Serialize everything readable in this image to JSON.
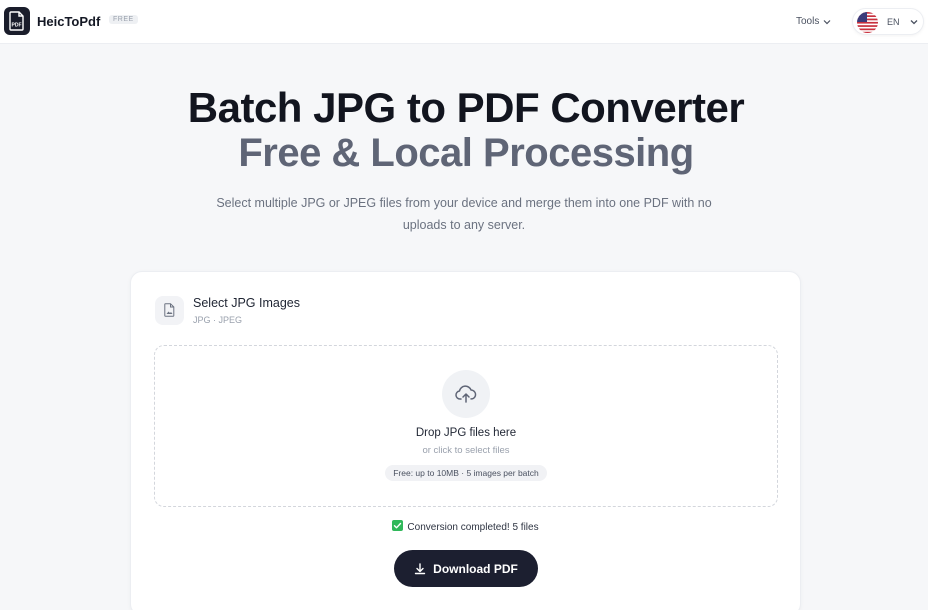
{
  "header": {
    "logo_icon": "pdf-file-icon",
    "brand": "HeicToPdf",
    "badge": "FREE",
    "tools_label": "Tools",
    "language": {
      "code": "EN",
      "flag": "us-flag-icon"
    }
  },
  "hero": {
    "title_line1": "Batch JPG to PDF Converter",
    "title_line2": "Free & Local Processing",
    "subtitle": "Select multiple JPG or JPEG files from your device and merge them into one PDF with no uploads to any server."
  },
  "card": {
    "title": "Select JPG Images",
    "subtitle": "JPG · JPEG",
    "dropzone": {
      "icon": "cloud-upload-icon",
      "title": "Drop JPG files here",
      "subtitle": "or click to select files",
      "limit": "Free: up to 10MB · 5 images per batch"
    },
    "status": "Conversion completed! 5 files",
    "download_label": "Download PDF"
  },
  "colors": {
    "primary_dark": "#1c1f30",
    "success": "#30b85a",
    "muted_text": "#6b7280"
  }
}
